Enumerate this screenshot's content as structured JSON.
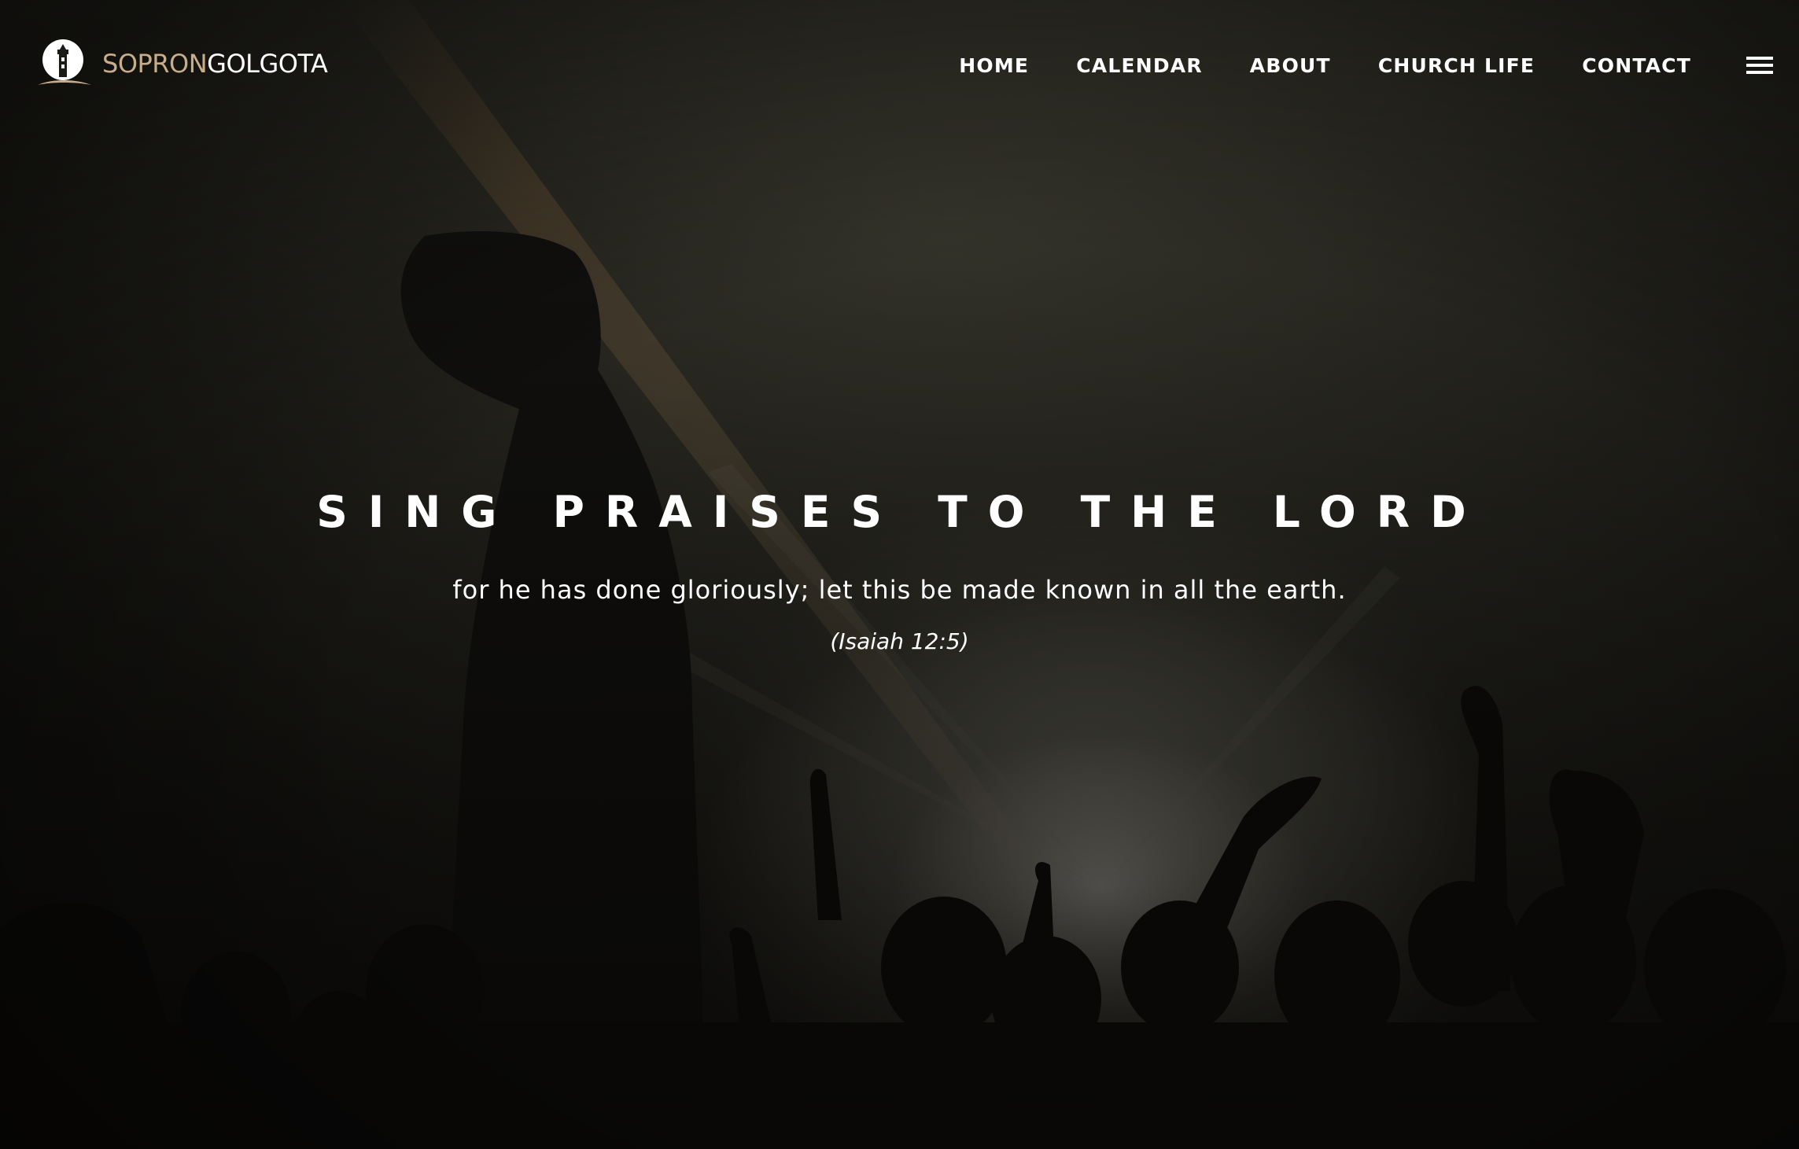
{
  "brand": {
    "name_part1": "SOPRON",
    "name_part2": "GOLGOTA",
    "accent_color": "#c8ad8a",
    "logo_icon": "lighthouse-icon"
  },
  "nav": {
    "items": [
      {
        "label": "HOME"
      },
      {
        "label": "CALENDAR"
      },
      {
        "label": "ABOUT"
      },
      {
        "label": "CHURCH LIFE"
      },
      {
        "label": "CONTACT"
      }
    ],
    "menu_icon": "hamburger-menu-icon"
  },
  "hero": {
    "headline": "SING PRAISES TO THE LORD",
    "subline": "for he has done gloriously; let this be made known in all the earth.",
    "reference": "(Isaiah 12:5)",
    "background": "worship-crowd-raised-hands-photo"
  }
}
